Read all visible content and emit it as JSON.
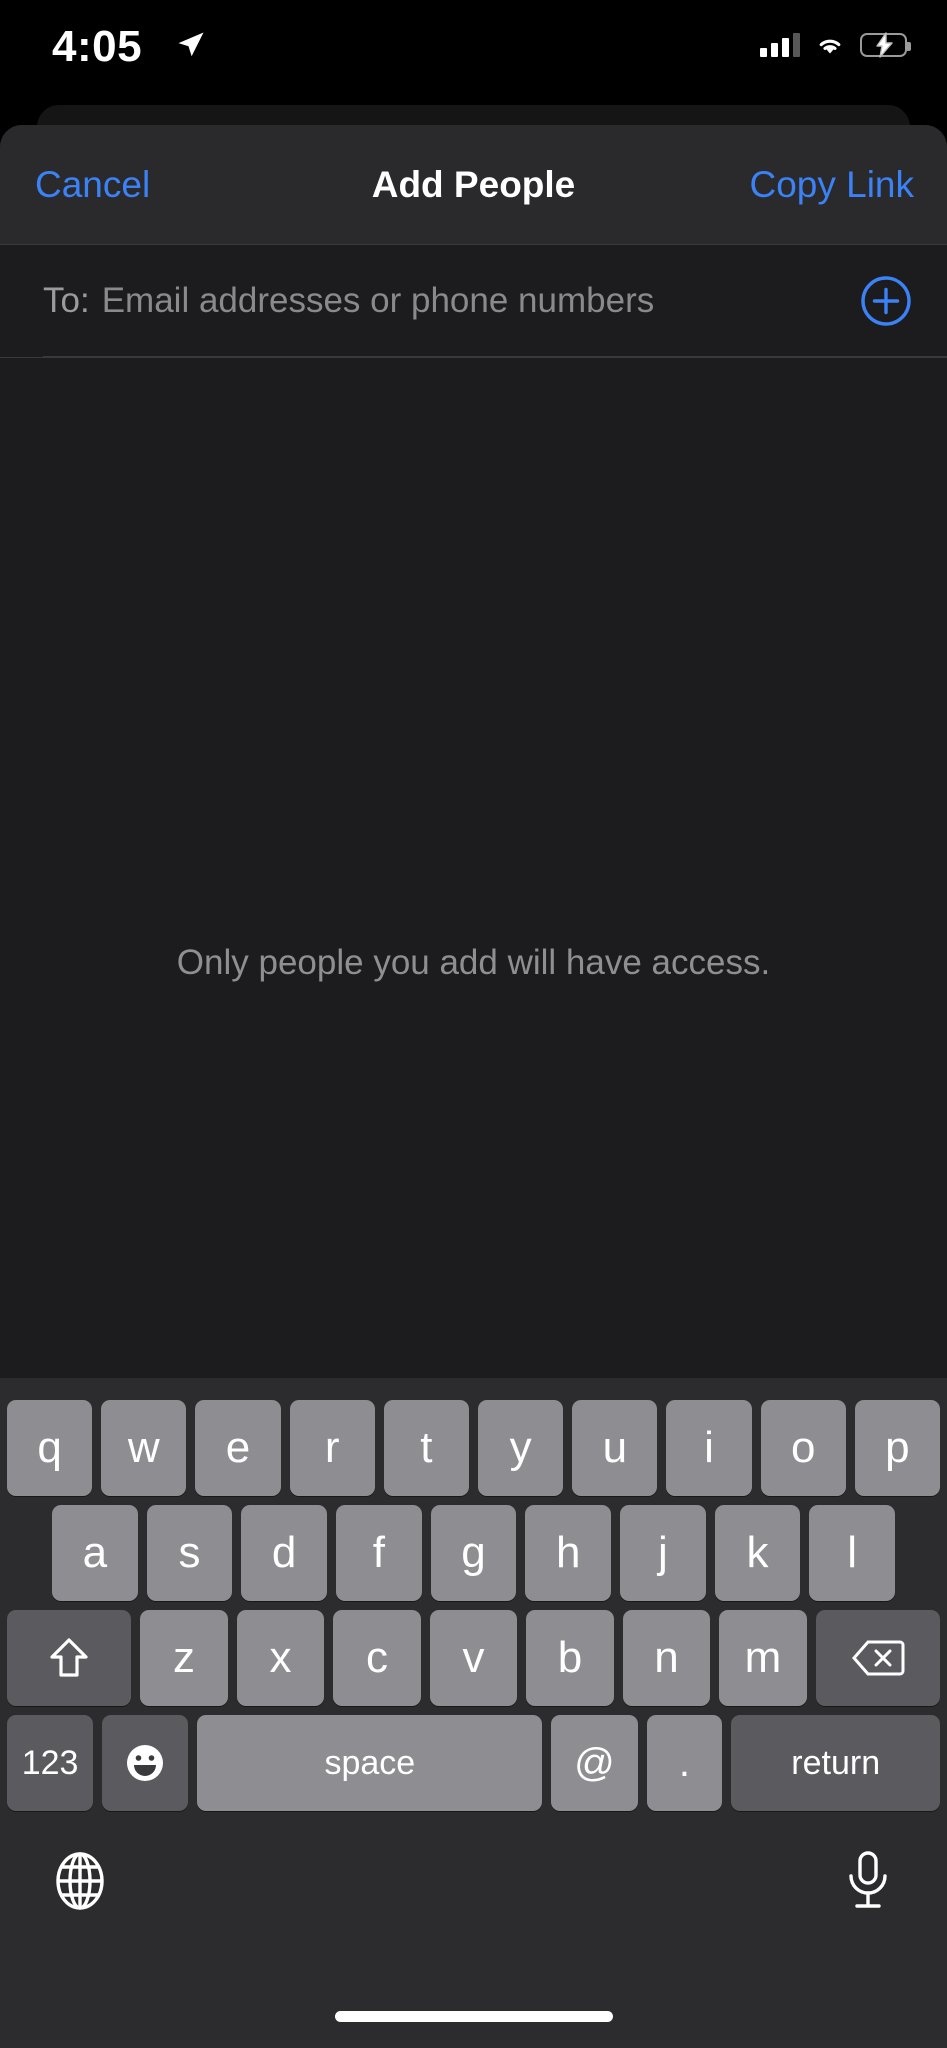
{
  "status_bar": {
    "time": "4:05",
    "location_icon": "location-arrow-icon",
    "cellular_icon": "cellular-bars-icon",
    "wifi_icon": "wifi-icon",
    "battery_icon": "battery-charging-icon",
    "battery_color": "#4cd964"
  },
  "nav": {
    "cancel_label": "Cancel",
    "title": "Add People",
    "copy_link_label": "Copy Link",
    "tint_color": "#3b82f6"
  },
  "recipients": {
    "to_label": "To:",
    "placeholder": "Email addresses or phone numbers",
    "value": "",
    "add_contact_icon": "plus-circle-icon"
  },
  "body": {
    "message": "Only people you add will have access."
  },
  "keyboard": {
    "row1": [
      "q",
      "w",
      "e",
      "r",
      "t",
      "y",
      "u",
      "i",
      "o",
      "p"
    ],
    "row2": [
      "a",
      "s",
      "d",
      "f",
      "g",
      "h",
      "j",
      "k",
      "l"
    ],
    "row3_letters": [
      "z",
      "x",
      "c",
      "v",
      "b",
      "n",
      "m"
    ],
    "shift_icon": "shift-arrow-icon",
    "delete_icon": "backspace-icon",
    "numbers_label": "123",
    "emoji_icon": "smiley-face-icon",
    "space_label": "space",
    "at_label": "@",
    "period_label": ".",
    "return_label": "return",
    "globe_icon": "globe-icon",
    "dictation_icon": "microphone-icon"
  },
  "home_indicator": "home-indicator"
}
